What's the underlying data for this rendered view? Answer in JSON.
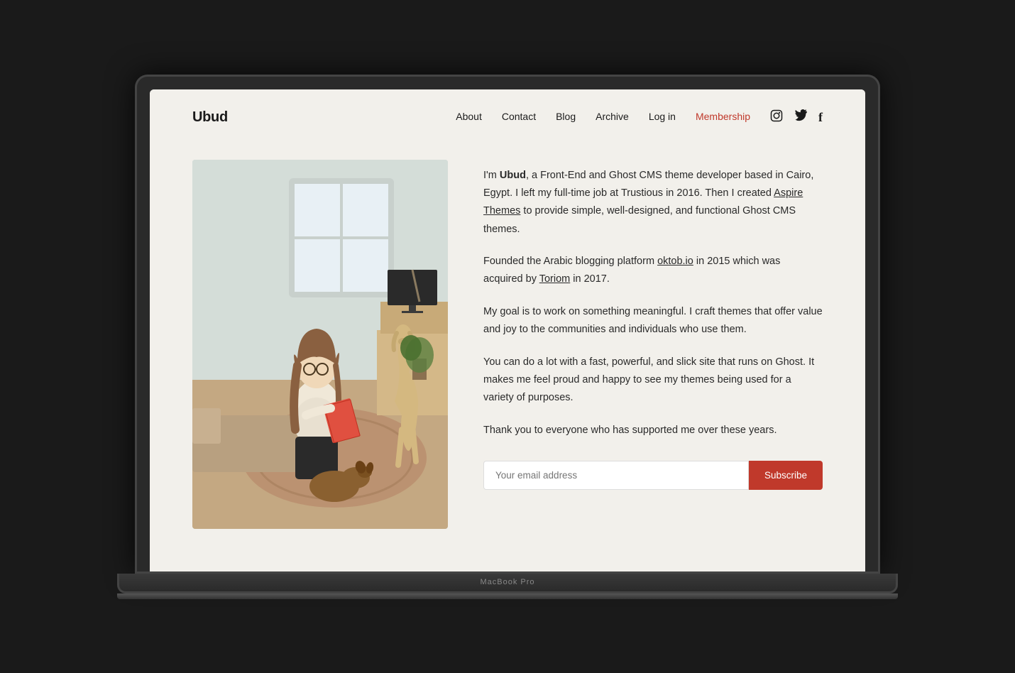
{
  "site": {
    "logo": "Ubud",
    "background_color": "#f2f0eb",
    "accent_color": "#c0392b"
  },
  "nav": {
    "links": [
      {
        "label": "About",
        "url": "#",
        "active": false
      },
      {
        "label": "Contact",
        "url": "#",
        "active": false
      },
      {
        "label": "Blog",
        "url": "#",
        "active": false
      },
      {
        "label": "Archive",
        "url": "#",
        "active": false
      },
      {
        "label": "Log in",
        "url": "#",
        "active": false
      },
      {
        "label": "Membership",
        "url": "#",
        "active": true,
        "color": "#c0392b"
      }
    ],
    "icons": [
      {
        "name": "instagram-icon",
        "symbol": "⬡"
      },
      {
        "name": "twitter-icon",
        "symbol": "𝕏"
      },
      {
        "name": "facebook-icon",
        "symbol": "f"
      }
    ]
  },
  "bio": {
    "paragraph1_prefix": "I'm ",
    "paragraph1_bold": "Ubud",
    "paragraph1_rest": ", a Front-End and Ghost CMS theme developer based in Cairo, Egypt. I left my full-time job at Trustious in 2016. Then I created ",
    "aspire_link": "Aspire Themes",
    "paragraph1_end": " to provide simple, well-designed, and functional Ghost CMS themes.",
    "paragraph2_prefix": "Founded the Arabic blogging platform ",
    "oktob_link": "oktob.io",
    "paragraph2_middle": " in 2015 which was acquired by ",
    "toriom_link": "Toriom",
    "paragraph2_end": " in 2017.",
    "paragraph3": "My goal is to work on something meaningful. I craft themes that offer value and joy to the communities and individuals who use them.",
    "paragraph4": "You can do a lot with a fast, powerful, and slick site that runs on Ghost. It makes me feel proud and happy to see my themes being used for a variety of purposes.",
    "paragraph5": "Thank you to everyone who has supported me over these years."
  },
  "subscribe": {
    "placeholder": "Your email address",
    "button_label": "Subscribe"
  },
  "laptop": {
    "model": "MacBook Pro"
  }
}
